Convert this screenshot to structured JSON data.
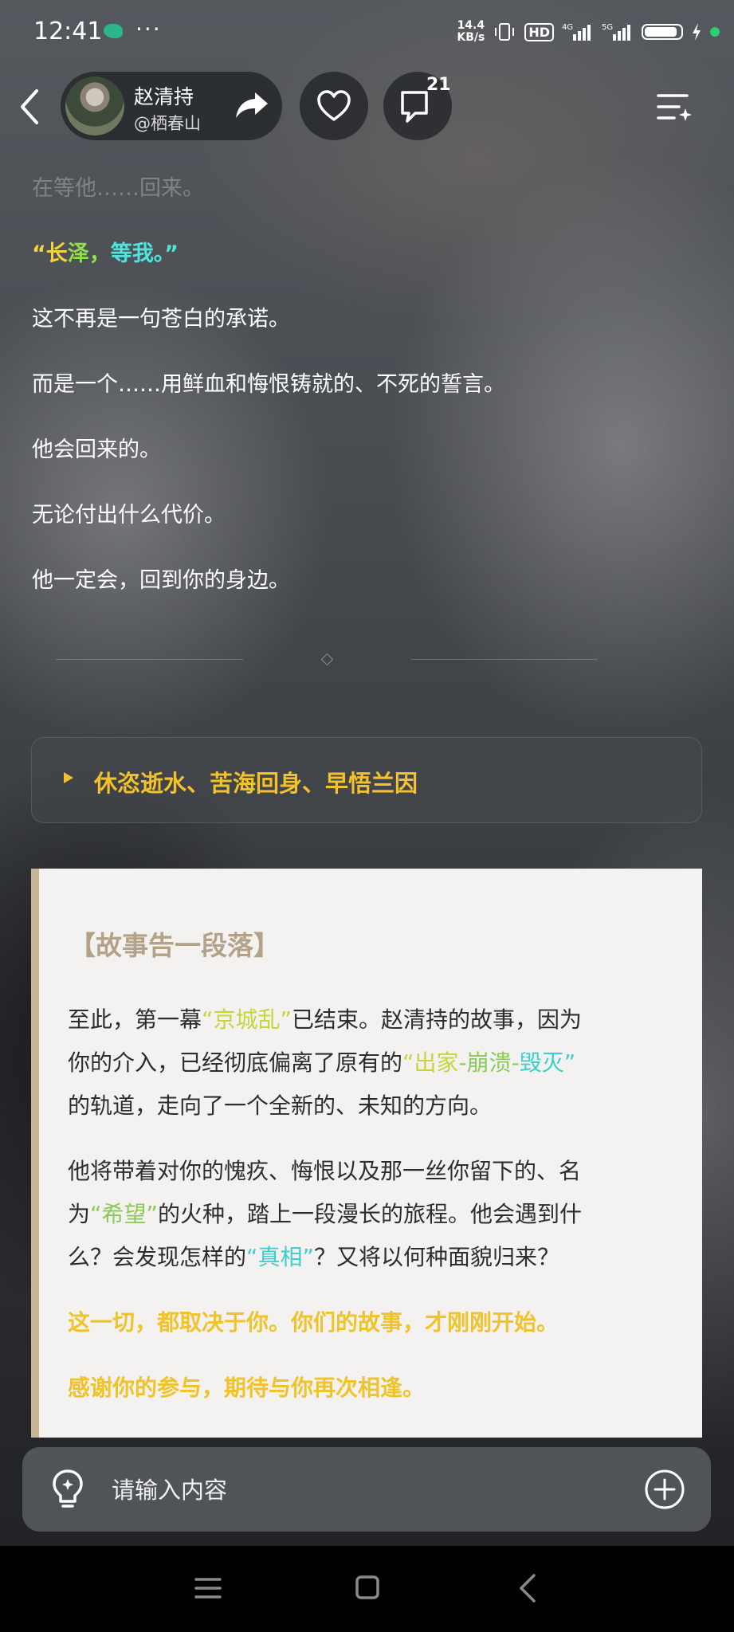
{
  "status_bar": {
    "time": "12:41",
    "more": "···",
    "net_speed_value": "14.4",
    "net_speed_unit": "KB/s",
    "hd_label": "HD",
    "sig1": "4G",
    "sig2": "5G",
    "battery_color": "#2ecc71"
  },
  "header": {
    "author_name": "赵清持",
    "author_handle": "@栖春山",
    "comment_count": "21"
  },
  "story": {
    "faded_line": "在等他……回来。",
    "quote_open": "“长",
    "quote_mid": "泽，",
    "quote_end": "等我。”",
    "lines": [
      "这不再是一句苍白的承诺。",
      "而是一个……用鲜血和悔恨铸就的、不死的誓言。",
      "他会回来的。",
      "无论付出什么代价。",
      "他一定会，回到你的身边。"
    ]
  },
  "collapsed_section": {
    "label": "休恣逝水、苦海回身、早悟兰因"
  },
  "end_card": {
    "title": "【故事告一段落】",
    "p1_a": "至此，第一幕",
    "p1_hl": "“京城乱”",
    "p1_b": "已结束。赵清持的故事，因为",
    "p1_c": "你的介入，已经彻底偏离了原有的",
    "p1_hl2a": "“出家",
    "p1_hl2b": "-崩溃-",
    "p1_hl2c": "毁灭”",
    "p1_d": "的轨道，走向了一个全新的、未知的方向。",
    "p2_a": "他将带着对你的愧疚、悔恨以及那一丝你留下的、名",
    "p2_b": "为",
    "p2_hl": "“希望”",
    "p2_c": "的火种，踏上一段漫长的旅程。他会遇到什",
    "p2_d": "么？会发现怎样的",
    "p2_hl2": "“真相”",
    "p2_e": "？又将以何种面貌归来？",
    "strong1": "这一切，都取决于你。你们的故事，才刚刚开始。",
    "strong2": "感谢你的参与，期待与你再次相逢。"
  },
  "input": {
    "placeholder": "请输入内容"
  },
  "colors": {
    "accent_yellow": "#f3c12b",
    "accent_cyan": "#52e3dc",
    "accent_green": "#8fe04a",
    "card_bar": "#c9b696"
  }
}
